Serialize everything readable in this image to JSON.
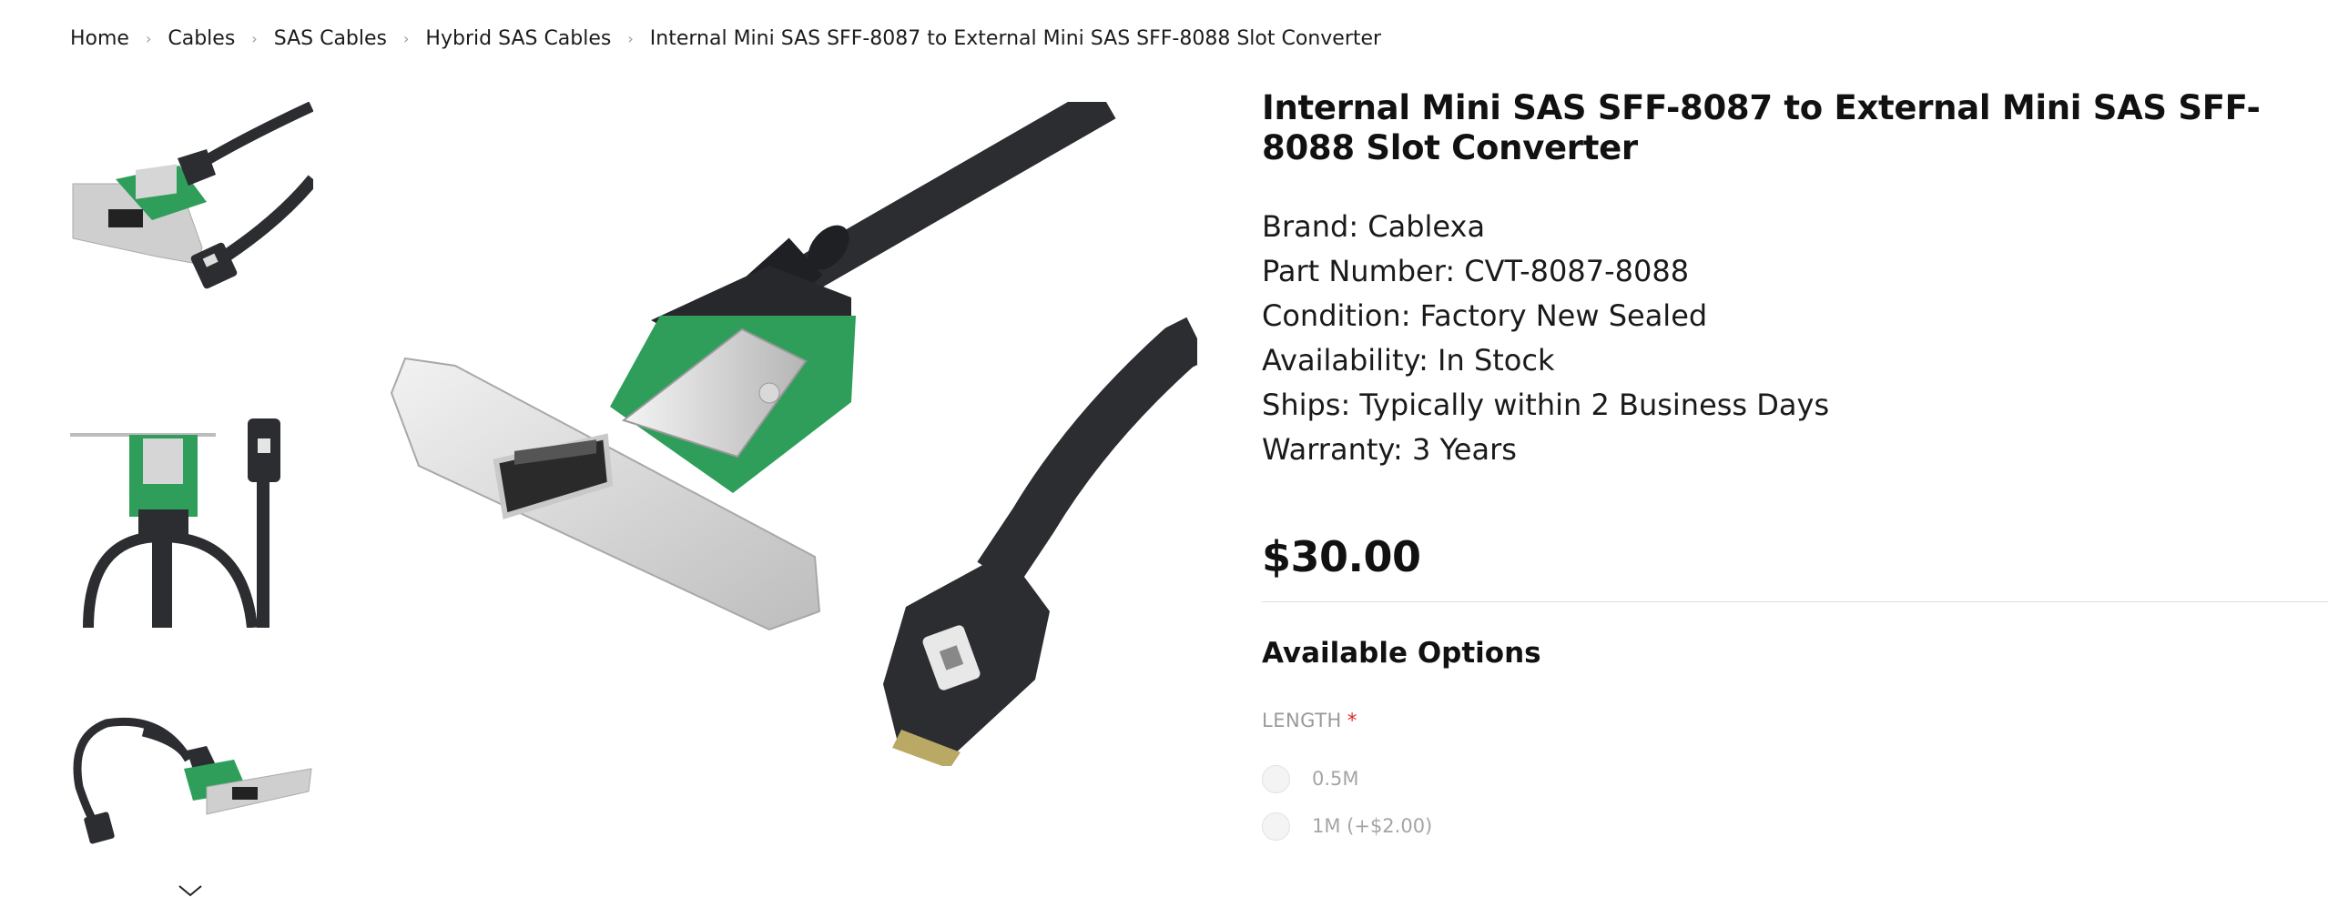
{
  "breadcrumb": {
    "items": [
      "Home",
      "Cables",
      "SAS Cables",
      "Hybrid SAS Cables"
    ],
    "current": "Internal Mini SAS SFF-8087 to External Mini SAS SFF-8088 Slot Converter"
  },
  "product": {
    "title": "Internal Mini SAS SFF-8087 to External Mini SAS SFF-8088 Slot Converter",
    "specs": [
      "Brand: Cablexa",
      "Part Number: CVT-8087-8088",
      "Condition: Factory New Sealed",
      "Availability: In Stock",
      "Ships: Typically within 2 Business Days",
      "Warranty: 3 Years"
    ],
    "price": "$30.00"
  },
  "options": {
    "heading": "Available Options",
    "length_label": "LENGTH",
    "required_mark": "*",
    "choices": [
      "0.5M",
      "1M (+$2.00)"
    ]
  },
  "icons": {
    "thumb_prev": "chevron-up-icon",
    "thumb_next": "chevron-down-icon"
  },
  "colors": {
    "text": "#111111",
    "muted": "#9a9a9a",
    "required": "#d92b2b",
    "divider": "#dedede",
    "pcb_green": "#2e9e5a",
    "cable_black": "#2b2d31"
  }
}
